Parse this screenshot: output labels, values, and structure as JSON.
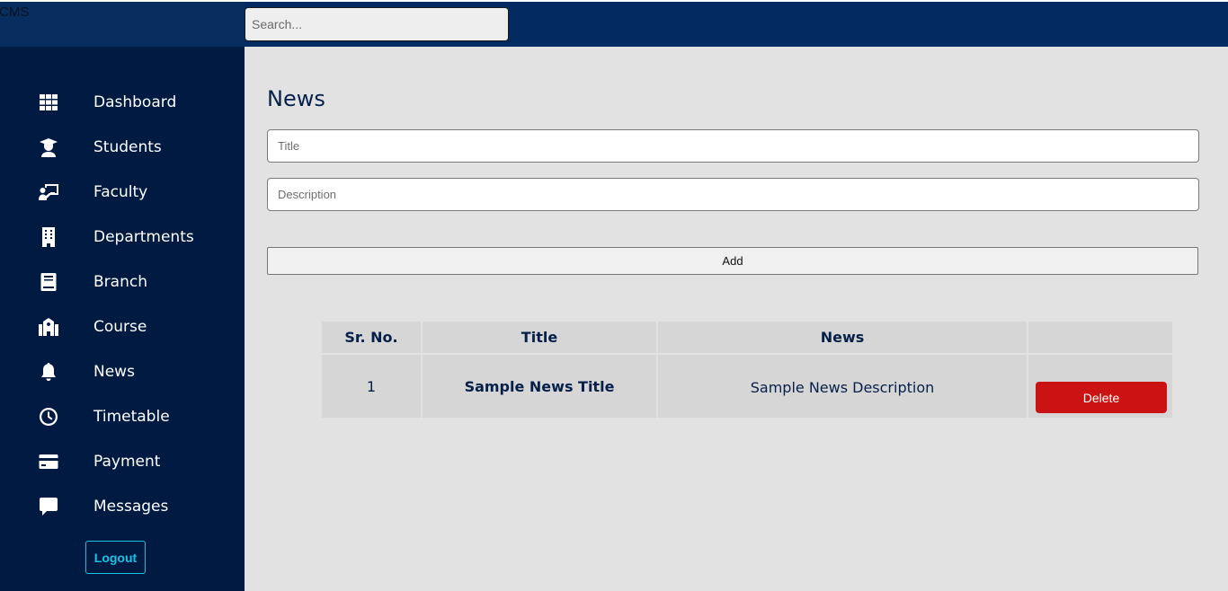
{
  "app": {
    "brand": "CMS"
  },
  "search": {
    "placeholder": "Search..."
  },
  "sidebar": {
    "items": [
      {
        "label": "Dashboard",
        "icon": "grid-icon"
      },
      {
        "label": "Students",
        "icon": "graduate-icon"
      },
      {
        "label": "Faculty",
        "icon": "teacher-icon"
      },
      {
        "label": "Departments",
        "icon": "building-icon"
      },
      {
        "label": "Branch",
        "icon": "book-icon"
      },
      {
        "label": "Course",
        "icon": "school-icon"
      },
      {
        "label": "News",
        "icon": "bell-icon"
      },
      {
        "label": "Timetable",
        "icon": "clock-icon"
      },
      {
        "label": "Payment",
        "icon": "credit-card-icon"
      },
      {
        "label": "Messages",
        "icon": "message-icon"
      }
    ],
    "logout_label": "Logout"
  },
  "main": {
    "title": "News",
    "form": {
      "title_placeholder": "Title",
      "description_placeholder": "Description",
      "add_label": "Add"
    },
    "table": {
      "headers": [
        "Sr. No.",
        "Title",
        "News",
        ""
      ],
      "rows": [
        {
          "sr_no": "1",
          "title": "Sample News Title",
          "news": "Sample News Description",
          "action_label": "Delete"
        }
      ]
    }
  },
  "colors": {
    "topbar": "#042b61",
    "sidebar": "#001a41",
    "main_bg": "#e3e2e3",
    "logout_accent": "#16c3e6",
    "delete": "#cc1313",
    "text_dark": "#06204a"
  }
}
